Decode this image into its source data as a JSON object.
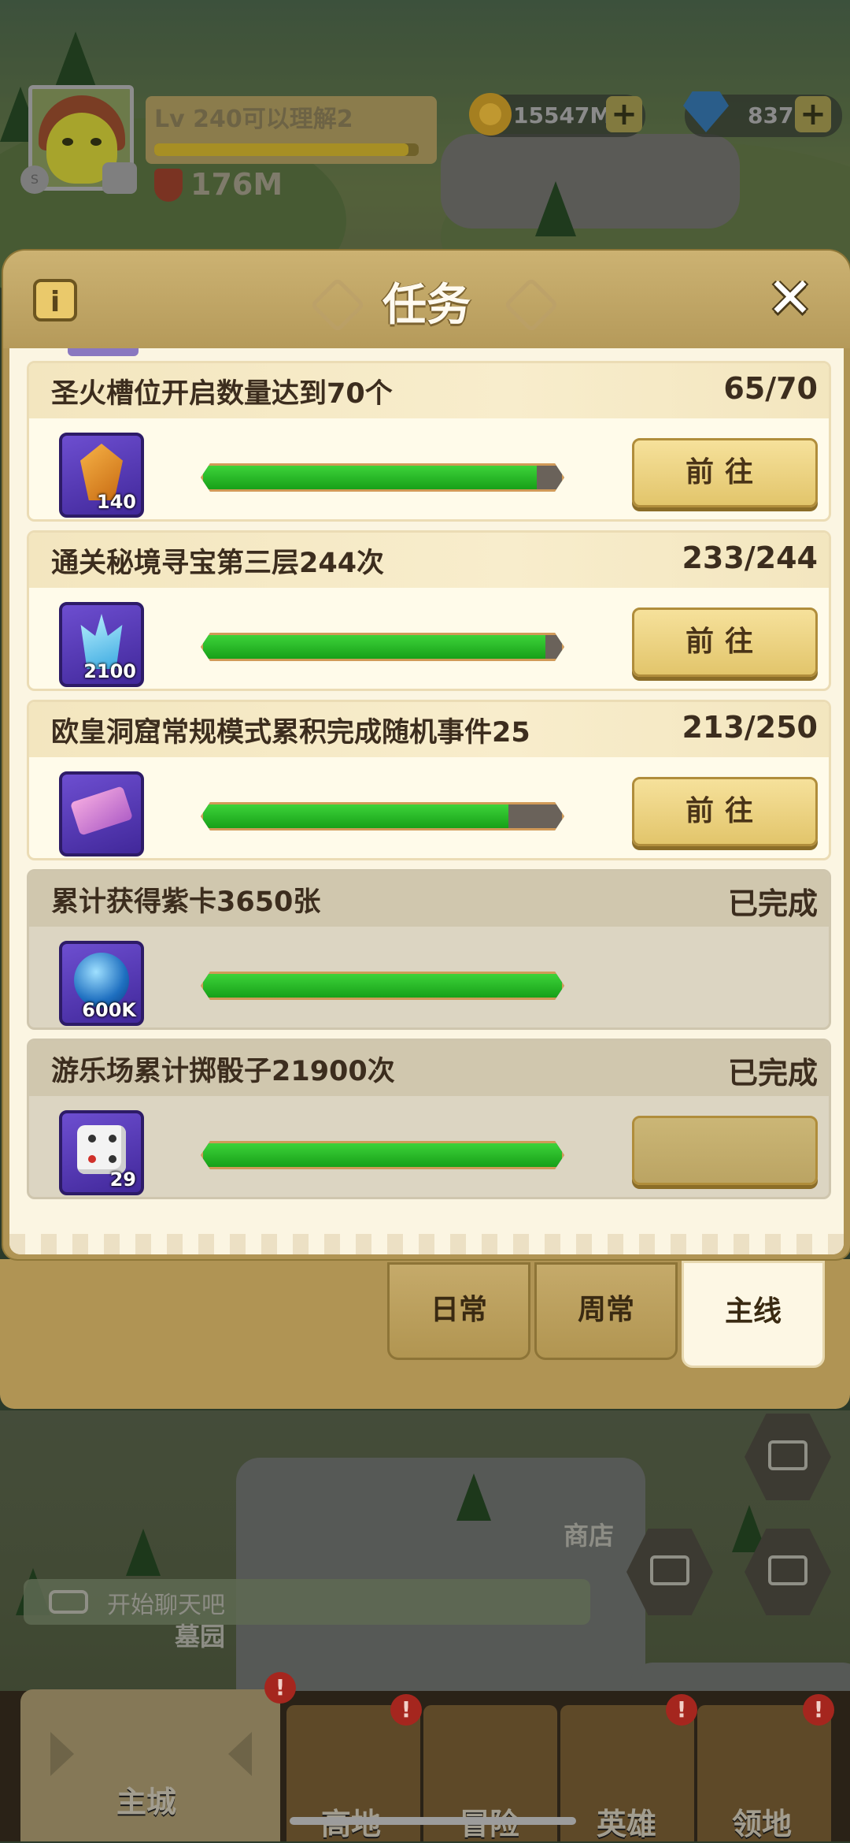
{
  "player": {
    "level_name": "Lv 240可以理解2",
    "power": "176M",
    "xp_progress": 0.96,
    "badge": "S"
  },
  "resources": {
    "gold": "15547M",
    "gems": "837K",
    "add_symbol": "+"
  },
  "modal": {
    "title": "任务",
    "info_symbol": "i",
    "close_symbol": "✕"
  },
  "tasks": [
    {
      "name": "圣火槽位开启数量达到70个",
      "progress": "65/70",
      "fill": 0.93,
      "reward_qty": "140",
      "reward_icon": "amber-crystal-icon",
      "button": "前往",
      "done": false
    },
    {
      "name": "通关秘境寻宝第三层244次",
      "progress": "233/244",
      "fill": 0.955,
      "reward_qty": "2100",
      "reward_icon": "blue-crystal-icon",
      "button": "前往",
      "done": false
    },
    {
      "name": "欧皇洞窟常规模式累积完成随机事件25",
      "progress": "213/250",
      "fill": 0.85,
      "reward_qty": "",
      "reward_icon": "ticket-icon",
      "button": "前往",
      "done": false
    },
    {
      "name": "累计获得紫卡3650张",
      "progress": "已完成",
      "fill": 1.0,
      "reward_qty": "600K",
      "reward_icon": "orb-icon",
      "button": "",
      "done": true
    },
    {
      "name": "游乐场累计掷骰子21900次",
      "progress": "已完成",
      "fill": 1.0,
      "reward_qty": "29",
      "reward_icon": "dice-icon",
      "button": "",
      "done": true
    }
  ],
  "tabs": [
    {
      "label": "日常",
      "active": false
    },
    {
      "label": "周常",
      "active": false
    },
    {
      "label": "主线",
      "active": true
    }
  ],
  "world": {
    "shop_label": "商店",
    "cemetery_label": "墓园",
    "chat_placeholder": "开始聊天吧"
  },
  "nav": {
    "main_city": "主城",
    "highland": "高地",
    "adventure": "冒险",
    "heroes": "英雄",
    "territory": "领地",
    "alert_symbol": "!"
  },
  "colors": {
    "accent": "#e2c56b",
    "progress_fill": "#2bbf29",
    "panel": "#b09454"
  }
}
